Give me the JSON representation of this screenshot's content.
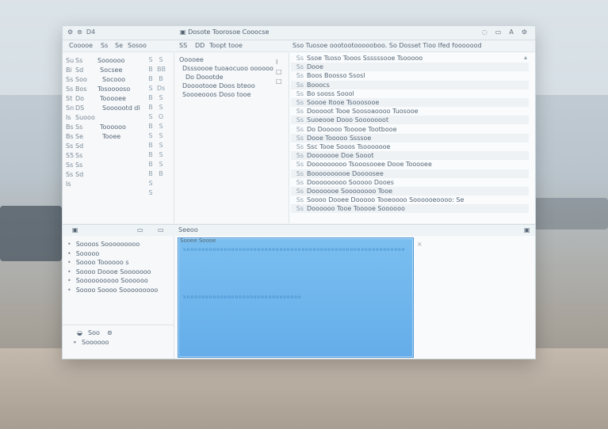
{
  "title_bar": {
    "left_icons": [
      "gear-icon",
      "settings-icon",
      "label-D4"
    ],
    "left_label": "D4",
    "window_title": "Dosote Toorosoe Cooocse",
    "right_icons": [
      "refresh-icon",
      "folder-icon",
      "a-icon",
      "settings-icon"
    ],
    "right_a": "A"
  },
  "left_toolbar": {
    "label": "Cooooe",
    "items": [
      "Ss",
      "Se",
      "Sosoo"
    ]
  },
  "mid_toolbar": {
    "items": [
      "SS",
      "DD",
      "Toopt tooe"
    ]
  },
  "right_toolbar": {
    "text": "Sso Tuosoe oootootoooooboo. So Dosset Tioo Ifed fooooood"
  },
  "left_tree": [
    {
      "g1": "Su",
      "g2": "Ss",
      "label": "Soooooo"
    },
    {
      "g1": "Bi",
      "g2": "Sd",
      "label": "Socsee"
    },
    {
      "g1": "Ss",
      "g2": "Soo",
      "label": "Socooo"
    },
    {
      "g1": "Ss",
      "g2": "Bos",
      "label": "Tosooooso"
    },
    {
      "g1": "St",
      "g2": "Do",
      "label": "Tooooee"
    },
    {
      "g1": "Sn",
      "g2": "DS",
      "label": "Soooootd dl"
    },
    {
      "g1": "Is",
      "g2": "Suooo",
      "label": ""
    },
    {
      "g1": "Bs",
      "g2": "Ss",
      "label": "Toooooo"
    },
    {
      "g1": "Bs",
      "g2": "Se",
      "label": "Tooee"
    },
    {
      "g1": "Ss",
      "g2": "Sd",
      "label": ""
    },
    {
      "g1": "S5",
      "g2": "Ss",
      "label": ""
    },
    {
      "g1": "Ss",
      "g2": "Ss",
      "label": ""
    },
    {
      "g1": "Ss",
      "g2": "Sd",
      "label": ""
    },
    {
      "g1": "Is",
      "g2": "",
      "label": ""
    }
  ],
  "left_scroll_marks": [
    "S",
    "B",
    "B",
    "S",
    "B",
    "B",
    "S",
    "B",
    "S",
    "B",
    "B",
    "B",
    "B",
    "S",
    "S"
  ],
  "mid_tree": [
    {
      "text": "Ooooee"
    },
    {
      "text": "Dsssoooe tuoaocuoo oooooo"
    },
    {
      "text": "Do Doootde"
    },
    {
      "text": "Dooootooe Doos bteoo"
    },
    {
      "text": "Soooeooos Doso tooe"
    }
  ],
  "mid_side_marks": [
    "S",
    "BB",
    "B",
    "Ds",
    "S",
    "S",
    "O",
    "S",
    "S",
    "S",
    "S",
    "S",
    "B"
  ],
  "code_lines": [
    {
      "n": "Ss",
      "t": "Ssoe Tsoso Tooos Ssssssooe Tsooooo"
    },
    {
      "n": "Ss",
      "t": "Dooe"
    },
    {
      "n": "Ss",
      "t": "Boos Boosso Ssosl"
    },
    {
      "n": "Ss",
      "t": "Booocs"
    },
    {
      "n": "Ss",
      "t": "Bo sooss Soool"
    },
    {
      "n": "Ss",
      "t": "Soooe Itooe Tsooosooe"
    },
    {
      "n": "Ss",
      "t": "Dooooot Tooe Soosoaoooo Tuosooe"
    },
    {
      "n": "Ss",
      "t": "Suoeooe Dooo Sooooooot"
    },
    {
      "n": "Ss",
      "t": "Do Dooooo Tooooe Tootbooe"
    },
    {
      "n": "Ss",
      "t": "Dooe Tooooo Ssssoe"
    },
    {
      "n": "Ss",
      "t": "Ssc Tooe Sooos Tsooooooe"
    },
    {
      "n": "Ss",
      "t": "Dooooooe Doe Sooot"
    },
    {
      "n": "Ss",
      "t": "Dooooooooo Tsooosooee Dooe Tooooee"
    },
    {
      "n": "Ss",
      "t": "Boooooooooe Doooosee"
    },
    {
      "n": "Ss",
      "t": "Dooooooooo Sooooo Dooes"
    },
    {
      "n": "Ss",
      "t": "Dooooooe Soooooooo Tooe"
    },
    {
      "n": "Ss",
      "t": "Soooo Dooee Dooooo Tooeoooo Soooooeoooo: Se"
    },
    {
      "n": "Ss",
      "t": "Doooooo Tooe Tooooe Soooooo"
    }
  ],
  "bottom_bar": {
    "left_icons": [
      "image-icon",
      "folder-icon"
    ],
    "mid_label": "Seeoo",
    "right_icon": "window-icon"
  },
  "bottom_left_list": [
    "Soooos Sooooooooo",
    "Sooooo",
    "Soooo Toooooo s",
    "Soooo Doooe Sooooooo",
    "Soooooooooo Soooooo",
    "Soooo Soooo Sooooooooo"
  ],
  "bottom_left_footer": {
    "line1": "Soo",
    "line2": "Soooooo"
  },
  "blue_panel": {
    "header": "Sooee Soooe",
    "row1": "Soooooooooooooooooooooooooooooooooooooooooooooooooooooooooooooooooooooo",
    "row2": "Soooooooooooooooooooooooooooooooooooooooooooooooooooooo"
  },
  "colors": {
    "accent": "#64adea",
    "window_bg": "#f3f6f8",
    "text": "#556575"
  }
}
